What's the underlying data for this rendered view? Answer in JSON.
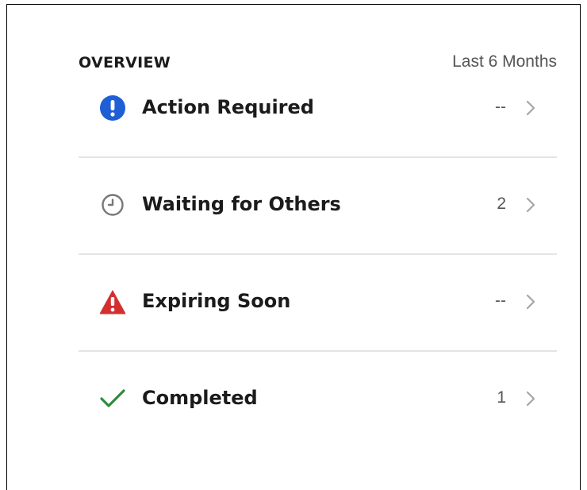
{
  "overview": {
    "title": "OVERVIEW",
    "period": "Last 6 Months"
  },
  "items": [
    {
      "label": "Action Required",
      "count": "--",
      "icon": "exclamation-circle-icon",
      "color": "#1e5fd6"
    },
    {
      "label": "Waiting for Others",
      "count": "2",
      "icon": "clock-icon",
      "color": "#777777"
    },
    {
      "label": "Expiring Soon",
      "count": "--",
      "icon": "warning-triangle-icon",
      "color": "#d32f2f"
    },
    {
      "label": "Completed",
      "count": "1",
      "icon": "checkmark-icon",
      "color": "#2e8b3e"
    }
  ]
}
